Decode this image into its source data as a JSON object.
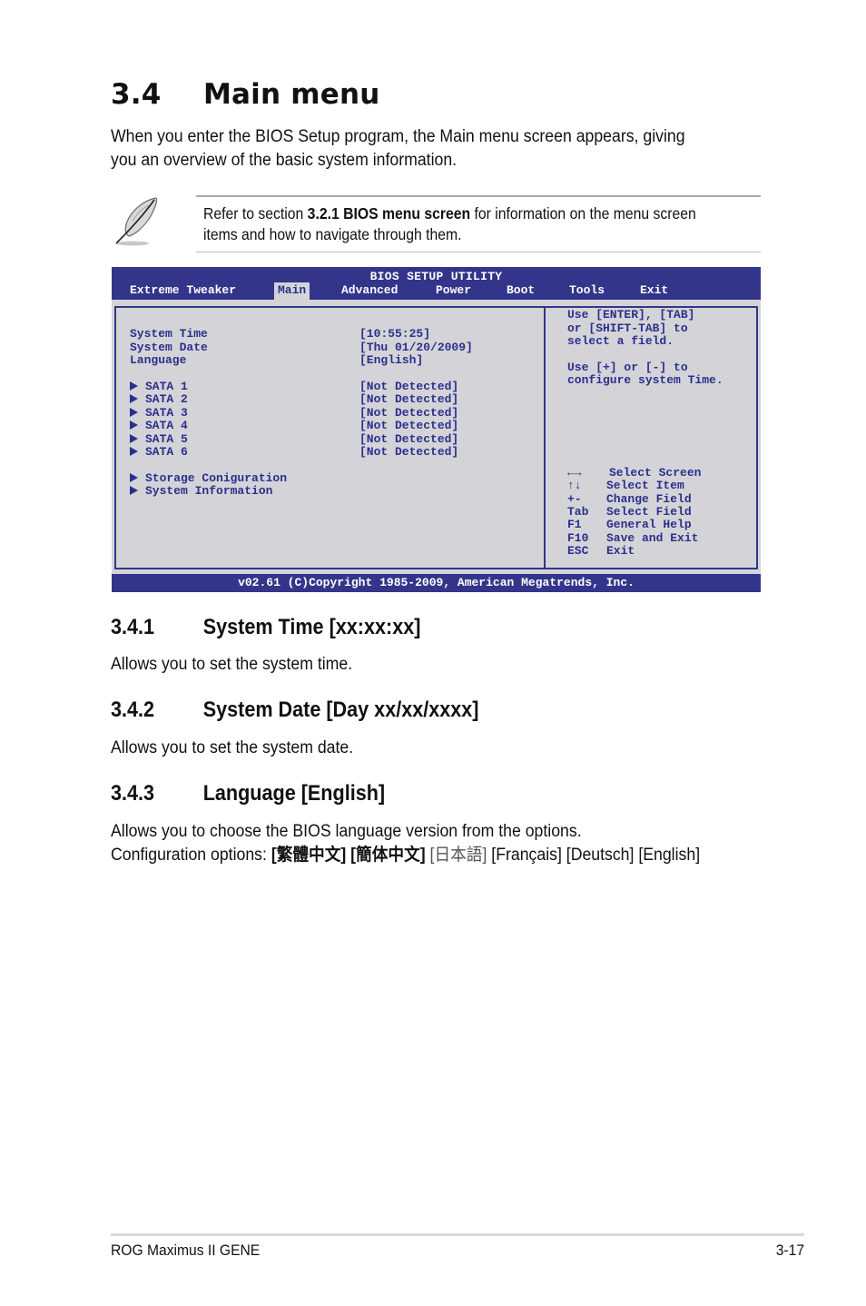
{
  "section": {
    "number": "3.4",
    "title": "Main menu",
    "intro_line1": "When you enter the BIOS Setup program, the Main menu screen appears, giving",
    "intro_line2": "you an overview of the basic system information."
  },
  "note": {
    "icon": "feather-icon",
    "prefix": "Refer to section ",
    "bold": "3.2.1  BIOS menu screen",
    "suffix": " for information on the menu screen",
    "line2": "items and how to navigate through them."
  },
  "bios": {
    "colors": {
      "header": "#33358a",
      "panel": "#d4d4d8",
      "text": "#2b2f8c"
    },
    "title": "BIOS SETUP UTILITY",
    "tabs": [
      {
        "label": "Extreme Tweaker",
        "active": false
      },
      {
        "label": "Main",
        "active": true
      },
      {
        "label": "Advanced",
        "active": false
      },
      {
        "label": "Power",
        "active": false
      },
      {
        "label": "Boot",
        "active": false
      },
      {
        "label": "Tools",
        "active": false
      },
      {
        "label": "Exit",
        "active": false
      }
    ],
    "items": [
      {
        "label": "System Time",
        "value": "[10:55:25]"
      },
      {
        "label": "System Date",
        "value": "[Thu 01/20/2009]"
      },
      {
        "label": "Language",
        "value": "[English]"
      }
    ],
    "sata": [
      {
        "label": "SATA 1",
        "value": "[Not Detected]"
      },
      {
        "label": "SATA 2",
        "value": "[Not Detected]"
      },
      {
        "label": "SATA 3",
        "value": "[Not Detected]"
      },
      {
        "label": "SATA 4",
        "value": "[Not Detected]"
      },
      {
        "label": "SATA 5",
        "value": "[Not Detected]"
      },
      {
        "label": "SATA 6",
        "value": "[Not Detected]"
      }
    ],
    "submenus": [
      {
        "label": "Storage Coniguration"
      },
      {
        "label": "System Information"
      }
    ],
    "help": [
      "Use [ENTER], [TAB]",
      "or [SHIFT-TAB] to",
      "select a field.",
      "",
      "Use [+] or [-] to",
      "configure system Time."
    ],
    "keys": [
      {
        "key": "←→",
        "action": "Select Screen"
      },
      {
        "key": "↑↓",
        "action": "Select Item"
      },
      {
        "key": "+-",
        "action": "Change Field"
      },
      {
        "key": "Tab",
        "action": "Select Field"
      },
      {
        "key": "F1",
        "action": "General Help"
      },
      {
        "key": "F10",
        "action": "Save and Exit"
      },
      {
        "key": "ESC",
        "action": "Exit"
      }
    ],
    "footer": "v02.61 (C)Copyright 1985-2009, American Megatrends, Inc."
  },
  "subsections": [
    {
      "number": "3.4.1",
      "title": "System Time [xx:xx:xx]",
      "body": "Allows you to set the system time."
    },
    {
      "number": "3.4.2",
      "title": "System Date [Day xx/xx/xxxx]",
      "body": "Allows you to set the system date."
    },
    {
      "number": "3.4.3",
      "title": "Language [English]",
      "body": "Allows you to choose the BIOS language version from the options."
    }
  ],
  "language_options": {
    "prefix": "Configuration options: ",
    "options": [
      "[繁體中文]",
      "[簡体中文]",
      "[日本語]",
      "[Français]",
      "[Deutsch]",
      "[English]"
    ]
  },
  "page_footer": {
    "product": "ROG Maximus II GENE",
    "page": "3-17"
  }
}
